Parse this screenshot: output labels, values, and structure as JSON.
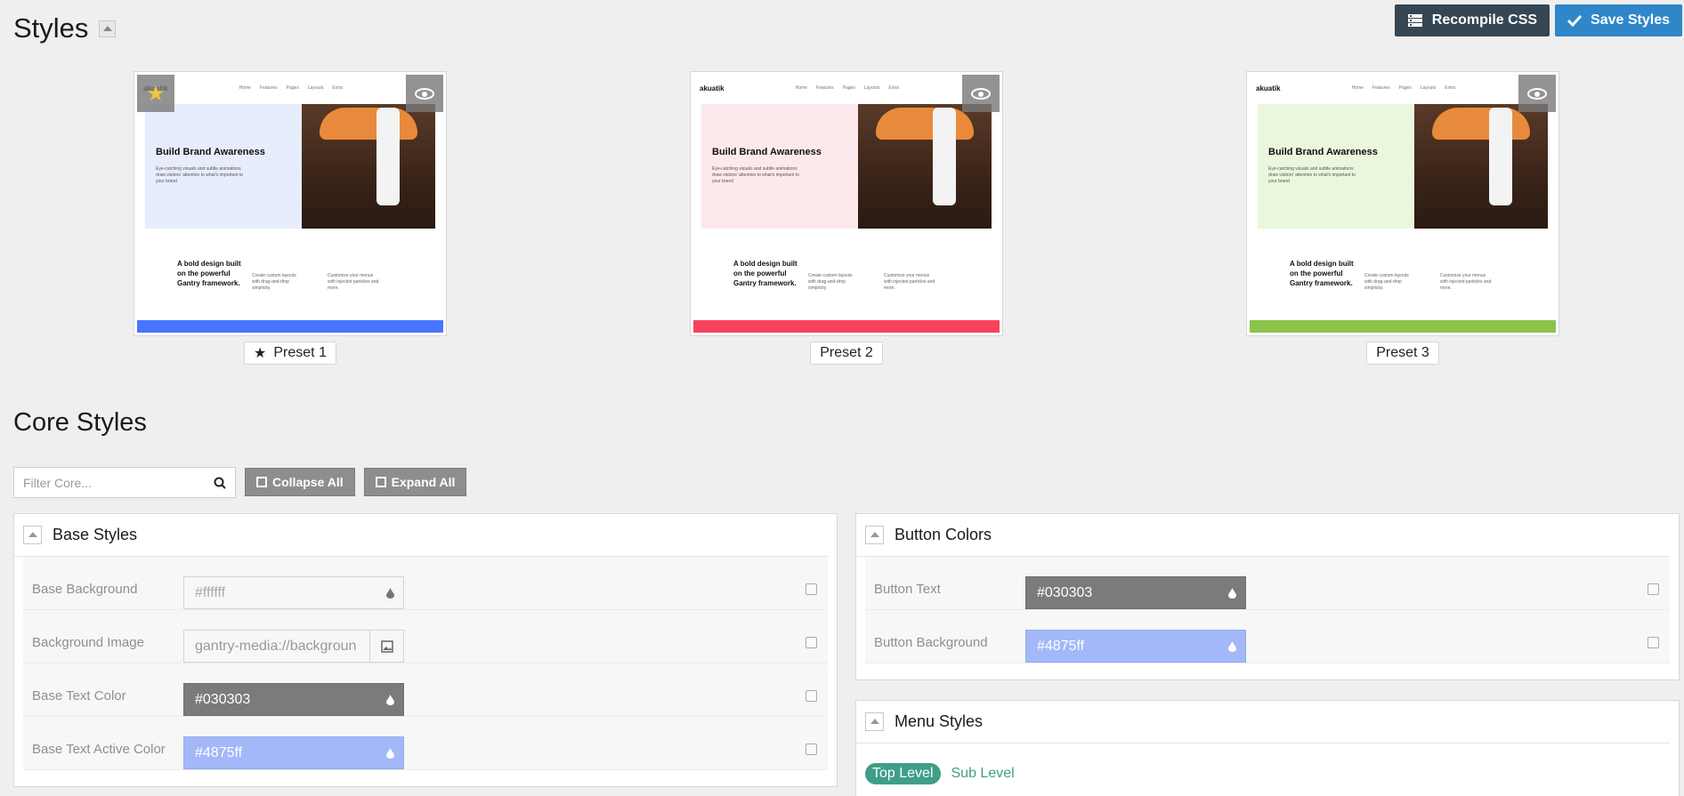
{
  "page": {
    "title": "Styles"
  },
  "actions": {
    "recompile_label": "Recompile CSS",
    "save_label": "Save Styles"
  },
  "presets": [
    {
      "label": "Preset 1",
      "accent": "#4875ff",
      "tint": "#e8edfd",
      "active": true
    },
    {
      "label": "Preset 2",
      "accent": "#f6435d",
      "tint": "#fde9ec",
      "active": false
    },
    {
      "label": "Preset 3",
      "accent": "#8bc34a",
      "tint": "#eaf7dd",
      "active": false
    }
  ],
  "thumb": {
    "logo": "akuatik",
    "menu": [
      "Home",
      "Features",
      "Pages",
      "Layouts",
      "Extra"
    ],
    "hero_title": "Build Brand Awareness",
    "hero_text": "Eye-catching visuals and subtle animations draw visitors' attention to what's important to your brand",
    "lower_title": "A bold design built on the powerful Gantry framework.",
    "col1": "Create custom layouts with drag-and-drop simplicity.",
    "col2": "Customize your menus with injected particles and more."
  },
  "core": {
    "title": "Core Styles",
    "filter_placeholder": "Filter Core...",
    "collapse_all": "Collapse All",
    "expand_all": "Expand All"
  },
  "base_styles": {
    "title": "Base Styles",
    "rows": [
      {
        "label": "Base Background",
        "value": "#ffffff"
      },
      {
        "label": "Background Image",
        "value": "gantry-media://backgroun"
      },
      {
        "label": "Base Text Color",
        "value": "#030303"
      },
      {
        "label": "Base Text Active Color",
        "value": "#4875ff"
      }
    ]
  },
  "button_colors": {
    "title": "Button Colors",
    "rows": [
      {
        "label": "Button Text",
        "value": "#030303"
      },
      {
        "label": "Button Background",
        "value": "#4875ff"
      }
    ]
  },
  "menu_styles": {
    "title": "Menu Styles",
    "tabs": [
      "Top Level",
      "Sub Level"
    ]
  },
  "colors": {
    "dark_button": "#364653",
    "primary": "#2f86c8",
    "teal": "#3f9e87"
  }
}
